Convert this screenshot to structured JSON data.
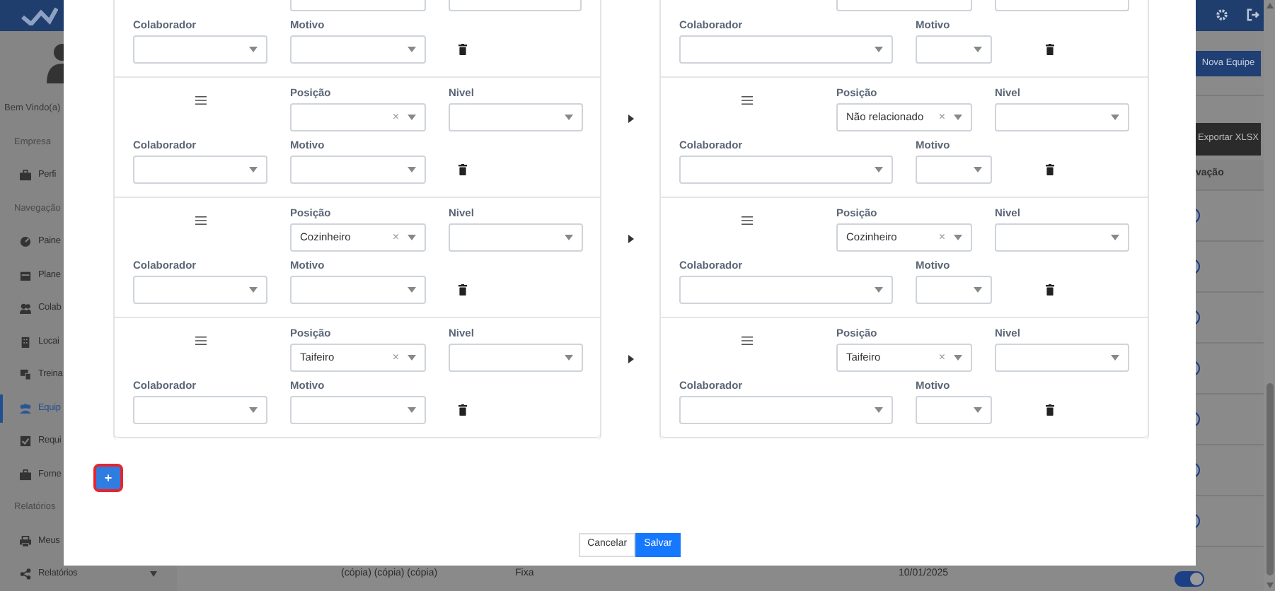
{
  "sidebar": {
    "greeting": "Bem Vindo(a)",
    "sections": [
      {
        "title": "Empresa",
        "items": [
          {
            "label": "Perfi",
            "selected": false
          }
        ]
      },
      {
        "title": "Navegação",
        "items": [
          {
            "label": "Paine",
            "selected": false
          },
          {
            "label": "Plane",
            "selected": false
          },
          {
            "label": "Colab",
            "selected": false
          },
          {
            "label": "Locai",
            "selected": false
          },
          {
            "label": "Treina",
            "selected": false
          },
          {
            "label": "Equip",
            "selected": true
          },
          {
            "label": "Requi",
            "selected": false
          },
          {
            "label": "Forne",
            "selected": false
          }
        ]
      },
      {
        "title": "Relatórios",
        "items": [
          {
            "label": "Meus",
            "selected": false
          },
          {
            "label": "Relatórios",
            "selected": false,
            "expandable": true
          }
        ]
      }
    ]
  },
  "toolbar": {
    "buttons": [
      {
        "label": "Nova Equipe",
        "kind": "primary"
      },
      {
        "label": "Exportar XLSX",
        "kind": "dark"
      }
    ]
  },
  "table": {
    "column_header": "vação",
    "toggles": [
      {
        "on": true
      },
      {
        "on": true
      },
      {
        "on": true
      },
      {
        "on": true
      },
      {
        "on": true
      },
      {
        "on": true
      },
      {
        "on": true
      }
    ],
    "last_row": {
      "cells": [
        "(cópia) (cópia) (cópia)",
        "Fixa",
        "10/01/2025"
      ],
      "on": true
    }
  },
  "modal": {
    "panels": [
      {
        "rows": [
          {
            "top_cut": true,
            "collaborator": {
              "label": "Colaborador"
            },
            "reason": {
              "label": "Motivo"
            }
          },
          {
            "top_cut": false,
            "position": {
              "label": "Posição",
              "clear": "×"
            },
            "level": {
              "label": "Nivel"
            },
            "collaborator": {
              "label": "Colaborador"
            },
            "reason": {
              "label": "Motivo"
            }
          },
          {
            "top_cut": false,
            "position": {
              "label": "Posição",
              "value": "Cozinheiro",
              "clear": "×"
            },
            "level": {
              "label": "Nivel"
            },
            "collaborator": {
              "label": "Colaborador"
            },
            "reason": {
              "label": "Motivo"
            }
          },
          {
            "top_cut": false,
            "position": {
              "label": "Posição",
              "value": "Taifeiro",
              "clear": "×"
            },
            "level": {
              "label": "Nivel"
            },
            "collaborator": {
              "label": "Colaborador"
            },
            "reason": {
              "label": "Motivo"
            }
          }
        ]
      },
      {
        "rows": [
          {
            "top_cut": true,
            "collaborator": {
              "label": "Colaborador"
            },
            "reason": {
              "label": "Motivo"
            }
          },
          {
            "top_cut": false,
            "position": {
              "label": "Posição",
              "value": "Não relacionado",
              "clear": "×"
            },
            "level": {
              "label": "Nivel"
            },
            "collaborator": {
              "label": "Colaborador"
            },
            "reason": {
              "label": "Motivo"
            }
          },
          {
            "top_cut": false,
            "position": {
              "label": "Posição",
              "value": "Cozinheiro",
              "clear": "×"
            },
            "level": {
              "label": "Nivel"
            },
            "collaborator": {
              "label": "Colaborador"
            },
            "reason": {
              "label": "Motivo"
            }
          },
          {
            "top_cut": false,
            "position": {
              "label": "Posição",
              "value": "Taifeiro",
              "clear": "×"
            },
            "level": {
              "label": "Nivel"
            },
            "collaborator": {
              "label": "Colaborador"
            },
            "reason": {
              "label": "Motivo"
            }
          }
        ]
      }
    ],
    "add_button": {
      "label": "+",
      "focused": true
    },
    "buttons": [
      {
        "label": "Cancelar",
        "kind": "secondary"
      },
      {
        "label": "Salvar",
        "kind": "primary"
      }
    ]
  }
}
